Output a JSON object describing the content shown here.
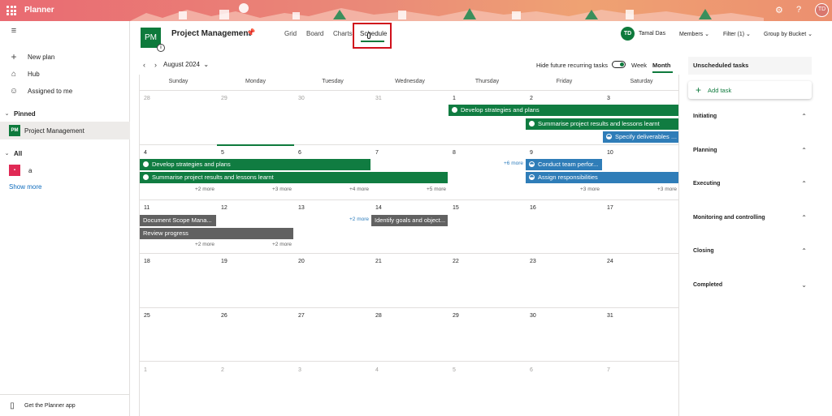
{
  "app": {
    "title": "Planner",
    "user_initials": "TD"
  },
  "leftnav": {
    "items": [
      {
        "label": "New plan",
        "icon": "plus-icon"
      },
      {
        "label": "Hub",
        "icon": "home-icon"
      },
      {
        "label": "Assigned to me",
        "icon": "person-icon"
      }
    ],
    "pinned_label": "Pinned",
    "pinned_plan": {
      "badge": "PM",
      "label": "Project Management"
    },
    "all_label": "All",
    "all_plan": {
      "badge": "▪",
      "label": "a"
    },
    "show_more": "Show more",
    "footer": "Get the Planner app"
  },
  "header": {
    "plan_badge": "PM",
    "plan_title": "Project Management",
    "tabs": [
      "Grid",
      "Board",
      "Charts",
      "Schedule"
    ],
    "user_initials": "TD",
    "user_name": "Tamal Das",
    "members": "Members",
    "filter": "Filter (1)",
    "group": "Group by Bucket"
  },
  "toolbar": {
    "month_label": "August 2024",
    "hide_recurring": "Hide future recurring tasks",
    "week": "Week",
    "month": "Month"
  },
  "calendar": {
    "weekdays": [
      "Sunday",
      "Monday",
      "Tuesday",
      "Wednesday",
      "Thursday",
      "Friday",
      "Saturday"
    ],
    "weeks": [
      [
        "28",
        "29",
        "30",
        "31",
        "1",
        "2",
        "3"
      ],
      [
        "4",
        "5",
        "6",
        "7",
        "8",
        "9",
        "10"
      ],
      [
        "11",
        "12",
        "13",
        "14",
        "15",
        "16",
        "17"
      ],
      [
        "18",
        "19",
        "20",
        "21",
        "22",
        "23",
        "24"
      ],
      [
        "25",
        "26",
        "27",
        "28",
        "29",
        "30",
        "31"
      ],
      [
        "1",
        "2",
        "3",
        "4",
        "5",
        "6",
        "7"
      ]
    ],
    "tasks": {
      "t1": "Develop strategies and plans",
      "t2": "Summarise project results and lessons learnt",
      "t3": "Specify deliverables a...",
      "t4": "Develop strategies and plans",
      "t5": "Summarise project results and lessons learnt",
      "t6": "Conduct team perfor...",
      "t7": "Assign responsibilities",
      "t8": "Document Scope Mana...",
      "t9": "Review progress",
      "t10": "Identify goals and object..."
    },
    "more": {
      "w2_thu": "+6 more",
      "w2_sun": "+2 more",
      "w2_mon": "+3 more",
      "w2_tue": "+4 more",
      "w2_wed": "+5 more",
      "w2_fri": "+3 more",
      "w2_sat": "+3 more",
      "w3_tue": "+2 more",
      "w3_sun": "+2 more",
      "w3_mon": "+2 more"
    }
  },
  "rightpanel": {
    "unscheduled": "Unscheduled tasks",
    "add_task": "Add task",
    "buckets": [
      "Initiating",
      "Planning",
      "Executing",
      "Monitoring and controlling",
      "Closing",
      "Completed"
    ]
  },
  "colors": {
    "brand_green": "#0e7a3c",
    "task_blue": "#2f7db8",
    "task_gray": "#616161",
    "highlight_red": "#d0101b"
  }
}
